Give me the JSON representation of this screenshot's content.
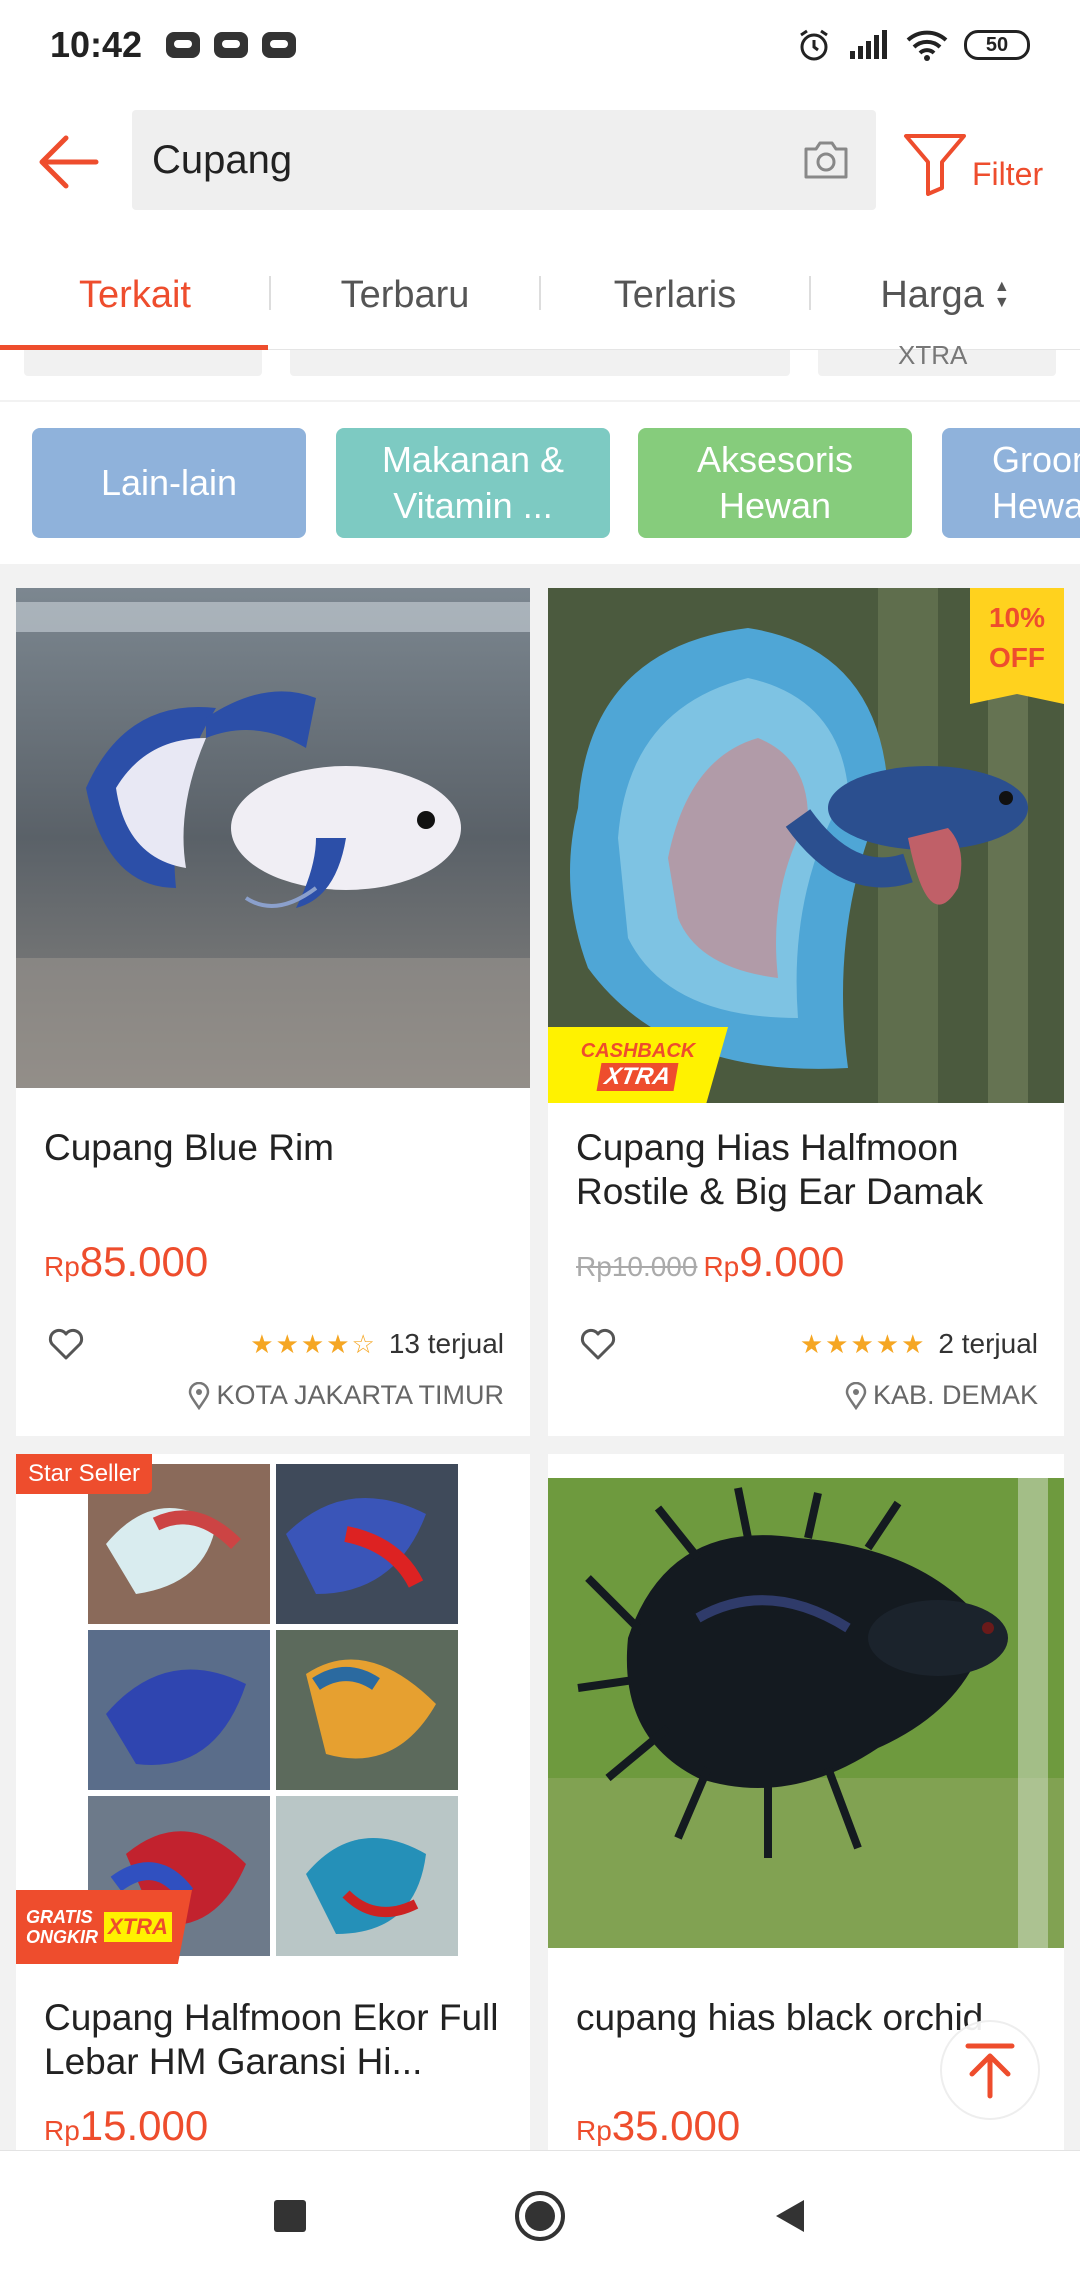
{
  "status_bar": {
    "time": "10:42",
    "battery": "50"
  },
  "search": {
    "query": "Cupang"
  },
  "filter": {
    "label": "Filter"
  },
  "tabs": [
    {
      "label": "Terkait",
      "active": true
    },
    {
      "label": "Terbaru"
    },
    {
      "label": "Terlaris"
    },
    {
      "label": "Harga"
    }
  ],
  "chip_remnant_text": "XTRA",
  "categories": [
    {
      "label": "Lain-lain",
      "color": "#8fb2db"
    },
    {
      "label": "Makanan & Vitamin ...",
      "color": "#7dcac2"
    },
    {
      "label": "Aksesoris Hewan",
      "color": "#86cc7c"
    },
    {
      "label": "Grooming Hewan",
      "color": "#8fb2db"
    }
  ],
  "products": [
    {
      "title": "Cupang Blue Rim",
      "price_currency": "Rp",
      "price": "85.000",
      "rating": 4,
      "sold": "13 terjual",
      "location": "KOTA JAKARTA TIMUR"
    },
    {
      "title": "Cupang Hias Halfmoon Rostile & Big Ear Damak",
      "old_price": "Rp10.000",
      "price_currency": "Rp",
      "price": "9.000",
      "rating": 5,
      "sold": "2 terjual",
      "location": "KAB. DEMAK",
      "badge_discount": "10% OFF",
      "badge_cashback_1": "CASHBACK",
      "badge_cashback_2": "XTRA"
    },
    {
      "title": "Cupang Halfmoon Ekor Full Lebar HM Garansi Hi...",
      "price_currency": "Rp",
      "price": "15.000",
      "badge_star": "Star Seller",
      "badge_ongkir_1": "GRATIS",
      "badge_ongkir_2": "ONGKIR",
      "badge_ongkir_3": "XTRA"
    },
    {
      "title": "cupang hias black orchid",
      "price_currency": "Rp",
      "price": "35.000"
    }
  ],
  "colors": {
    "accent": "#ee4d2d",
    "star": "#f5a623"
  }
}
